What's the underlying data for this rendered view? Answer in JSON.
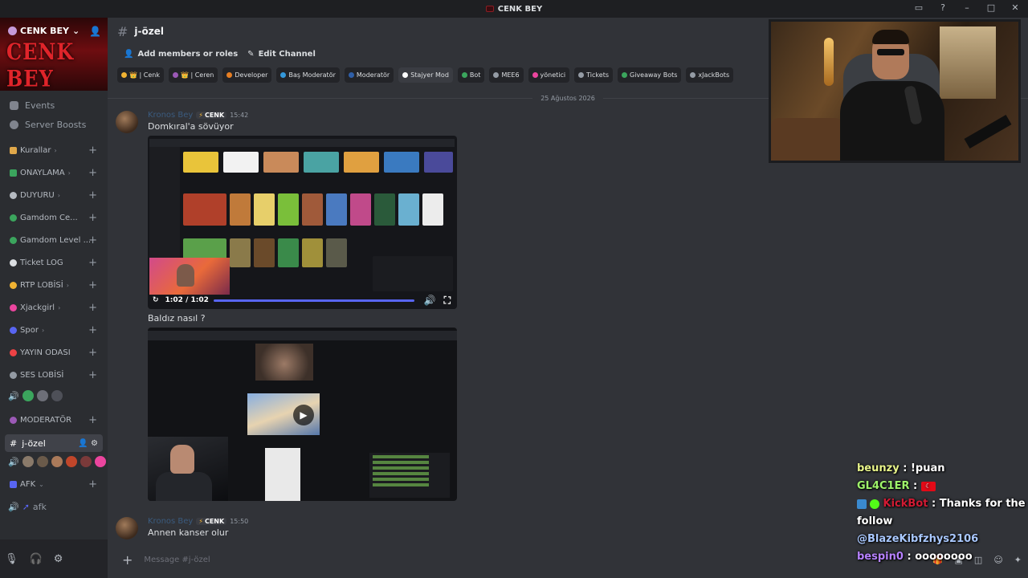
{
  "window": {
    "title": "CENK BEY"
  },
  "server": {
    "name": "CENK BEY",
    "banner_logo": "CENK BEY",
    "nav": [
      {
        "label": "Events",
        "icon": "calendar-icon"
      },
      {
        "label": "Server Boosts",
        "icon": "boost-icon"
      }
    ],
    "categories": [
      {
        "label": "Kurallar",
        "color": "#e0a84a"
      },
      {
        "label": "ONAYLAMA",
        "color": "#3ba55d"
      },
      {
        "label": "DUYURU",
        "color": "#b5bac1"
      },
      {
        "label": "Gamdom Ce...",
        "color": "#3ba55d"
      },
      {
        "label": "Gamdom Level ...",
        "color": "#3ba55d"
      },
      {
        "label": "Ticket LOG",
        "color": "#dbdee1"
      },
      {
        "label": "RTP LOBİSİ",
        "color": "#f0b232"
      },
      {
        "label": "Xjackgirl",
        "color": "#eb459e"
      },
      {
        "label": "Spor",
        "color": "#5865f2"
      },
      {
        "label": "YAYIN ODASI",
        "color": "#ed4245"
      },
      {
        "label": "SES LOBİSİ",
        "color": "#949ba4"
      }
    ],
    "moderator_category": "MODERATÖR",
    "active_channel": "j-özel",
    "afk_category": "AFK",
    "afk_channel": "afk"
  },
  "channel": {
    "name": "j-özel",
    "actions": [
      {
        "label": "Add members or roles",
        "icon": "add-member-icon"
      },
      {
        "label": "Edit Channel",
        "icon": "pencil-icon"
      }
    ],
    "roles": [
      {
        "label": "👑 | Cenk",
        "color": "#f0b232"
      },
      {
        "label": "👑 | Ceren",
        "color": "#9b59b6"
      },
      {
        "label": "Developer",
        "color": "#e67e22"
      },
      {
        "label": "Baş Moderatör",
        "color": "#3498db"
      },
      {
        "label": "Moderatör",
        "color": "#2f5fa8"
      },
      {
        "label": "Stajyer Mod",
        "color": "#ffffff"
      },
      {
        "label": "Bot",
        "color": "#3ba55d"
      },
      {
        "label": "MEE6",
        "color": "#949ba4"
      },
      {
        "label": "yönetici",
        "color": "#eb459e"
      },
      {
        "label": "Tickets",
        "color": "#949ba4"
      },
      {
        "label": "Giveaway Bots",
        "color": "#3ba55d"
      },
      {
        "label": "xJackBots",
        "color": "#949ba4"
      }
    ],
    "date_divider": "25 Ağustos 2026",
    "messages": [
      {
        "author": "Kronos Bey",
        "tag": "CENK",
        "time": "15:42",
        "text": "Domkıral'a sövüyor"
      },
      {
        "author": "",
        "tag": "",
        "time": "",
        "text": "Baldız nasıl ?"
      },
      {
        "author": "Kronos Bey",
        "tag": "CENK",
        "time": "15:50",
        "text": "Annen kanser olur"
      }
    ],
    "video": {
      "time_label": "1:02 / 1:02",
      "progress": 1.0
    },
    "composer_placeholder": "Message #j-özel"
  },
  "stream_chat": [
    {
      "user": "beunzy",
      "message": "!puan",
      "color": "#e8f48a"
    },
    {
      "user": "GL4C1ER",
      "message": "",
      "color": "#9ff56a"
    },
    {
      "user": "KickBot",
      "message": "Thanks for the follow",
      "color": "#d11a33"
    },
    {
      "user": "",
      "message": "@BlazeKibfzhys2106",
      "color": "#a9c8ff"
    },
    {
      "user": "bespin0",
      "message": "oooooooo",
      "color": "#b681ff"
    }
  ]
}
